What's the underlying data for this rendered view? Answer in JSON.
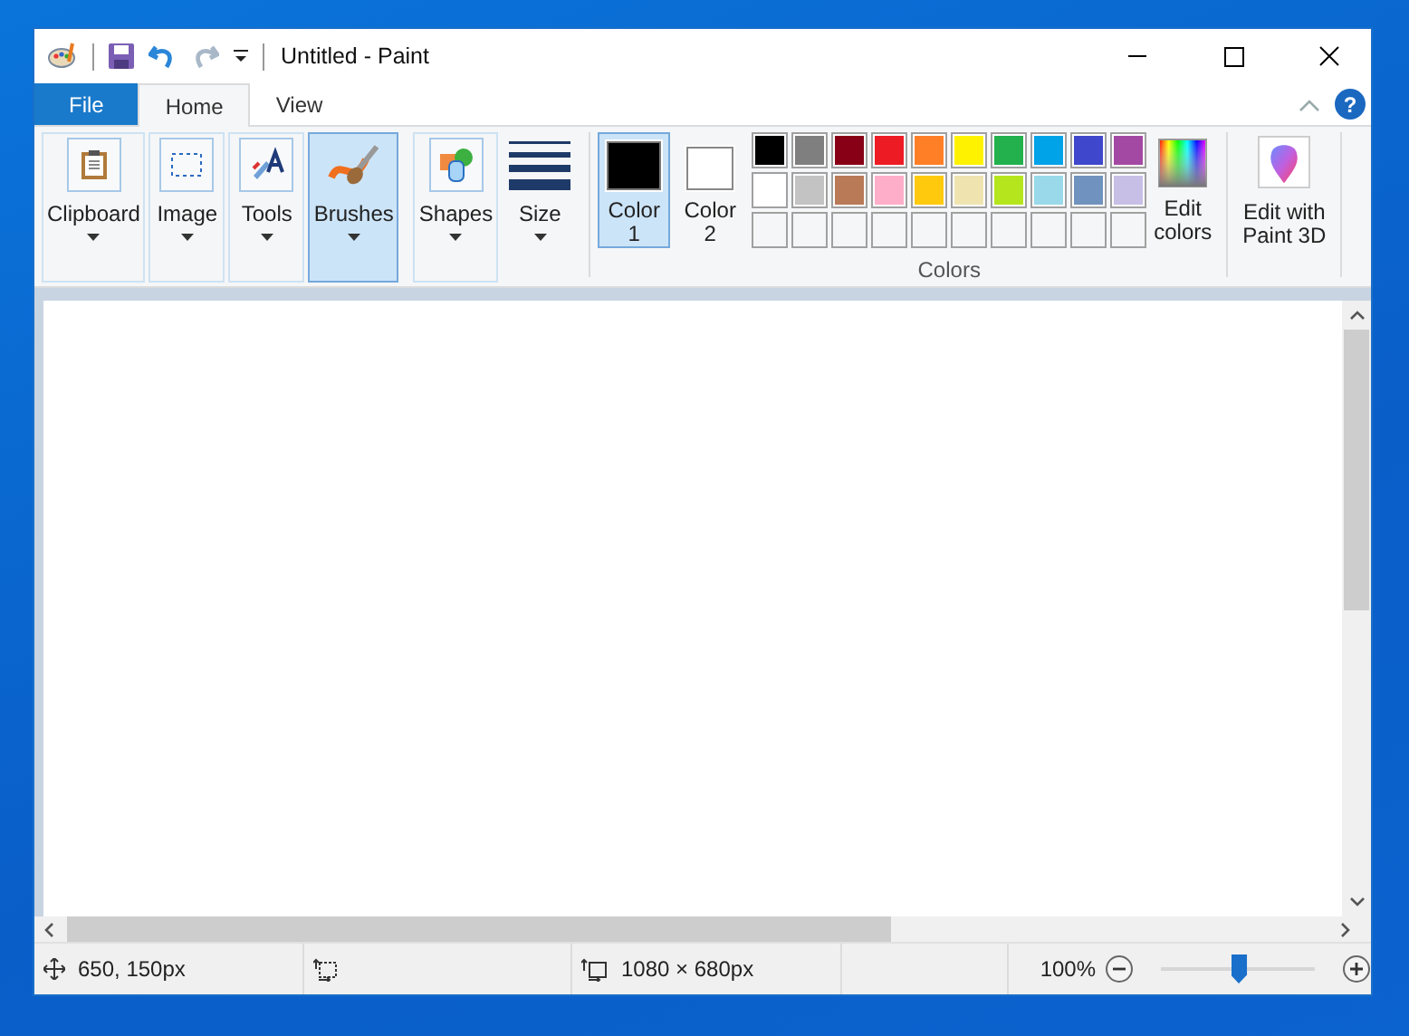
{
  "window": {
    "title": "Untitled - Paint"
  },
  "tabs": [
    {
      "label": "File",
      "kind": "file",
      "selected": false
    },
    {
      "label": "Home",
      "kind": "tab",
      "selected": true
    },
    {
      "label": "View",
      "kind": "tab",
      "selected": false
    }
  ],
  "help_button": "?",
  "tools": [
    {
      "label": "Clipboard",
      "kind": "clipboard",
      "selected": false
    },
    {
      "label": "Image",
      "kind": "image",
      "selected": false
    },
    {
      "label": "Tools",
      "kind": "tools",
      "selected": false
    },
    {
      "label": "Brushes",
      "kind": "brushes",
      "selected": true
    },
    {
      "label": "Shapes",
      "kind": "shapes",
      "selected": false
    },
    {
      "label": "Size",
      "kind": "size",
      "selected": false
    }
  ],
  "color_slots": [
    {
      "lines": [
        "Color",
        "1"
      ],
      "color": "#000000",
      "selected": true
    },
    {
      "lines": [
        "Color",
        "2"
      ],
      "color": "#ffffff",
      "selected": false
    }
  ],
  "palette": [
    [
      {
        "kind": "swatch",
        "color": "#000000"
      },
      {
        "kind": "swatch",
        "color": "#7f7f7f"
      },
      {
        "kind": "swatch",
        "color": "#880015"
      },
      {
        "kind": "swatch",
        "color": "#ed1c24"
      },
      {
        "kind": "swatch",
        "color": "#ff7f27"
      },
      {
        "kind": "swatch",
        "color": "#fff200"
      },
      {
        "kind": "swatch",
        "color": "#22b14c"
      },
      {
        "kind": "swatch",
        "color": "#00a2e8"
      },
      {
        "kind": "swatch",
        "color": "#3f48cc"
      },
      {
        "kind": "swatch",
        "color": "#a349a4"
      }
    ],
    [
      {
        "kind": "swatch",
        "color": "#ffffff"
      },
      {
        "kind": "swatch",
        "color": "#c3c3c3"
      },
      {
        "kind": "swatch",
        "color": "#b97a57"
      },
      {
        "kind": "swatch",
        "color": "#ffaec9"
      },
      {
        "kind": "swatch",
        "color": "#ffc90e"
      },
      {
        "kind": "swatch",
        "color": "#efe4b0"
      },
      {
        "kind": "swatch",
        "color": "#b5e61d"
      },
      {
        "kind": "swatch",
        "color": "#99d9ea"
      },
      {
        "kind": "swatch",
        "color": "#7092be"
      },
      {
        "kind": "swatch",
        "color": "#c8bfe7"
      }
    ],
    [
      {
        "kind": "empty"
      },
      {
        "kind": "empty"
      },
      {
        "kind": "empty"
      },
      {
        "kind": "empty"
      },
      {
        "kind": "empty"
      },
      {
        "kind": "empty"
      },
      {
        "kind": "empty"
      },
      {
        "kind": "empty"
      },
      {
        "kind": "empty"
      },
      {
        "kind": "empty"
      }
    ]
  ],
  "colors_group_label": "Colors",
  "edit_colors": [
    "Edit",
    "colors"
  ],
  "paint3d": [
    "Edit with",
    "Paint 3D"
  ],
  "status_bar": {
    "position": "650, 150px",
    "canvas_size": "1080 × 680px",
    "zoom": "100%",
    "zoom_level": {
      "level": 0.5
    }
  }
}
